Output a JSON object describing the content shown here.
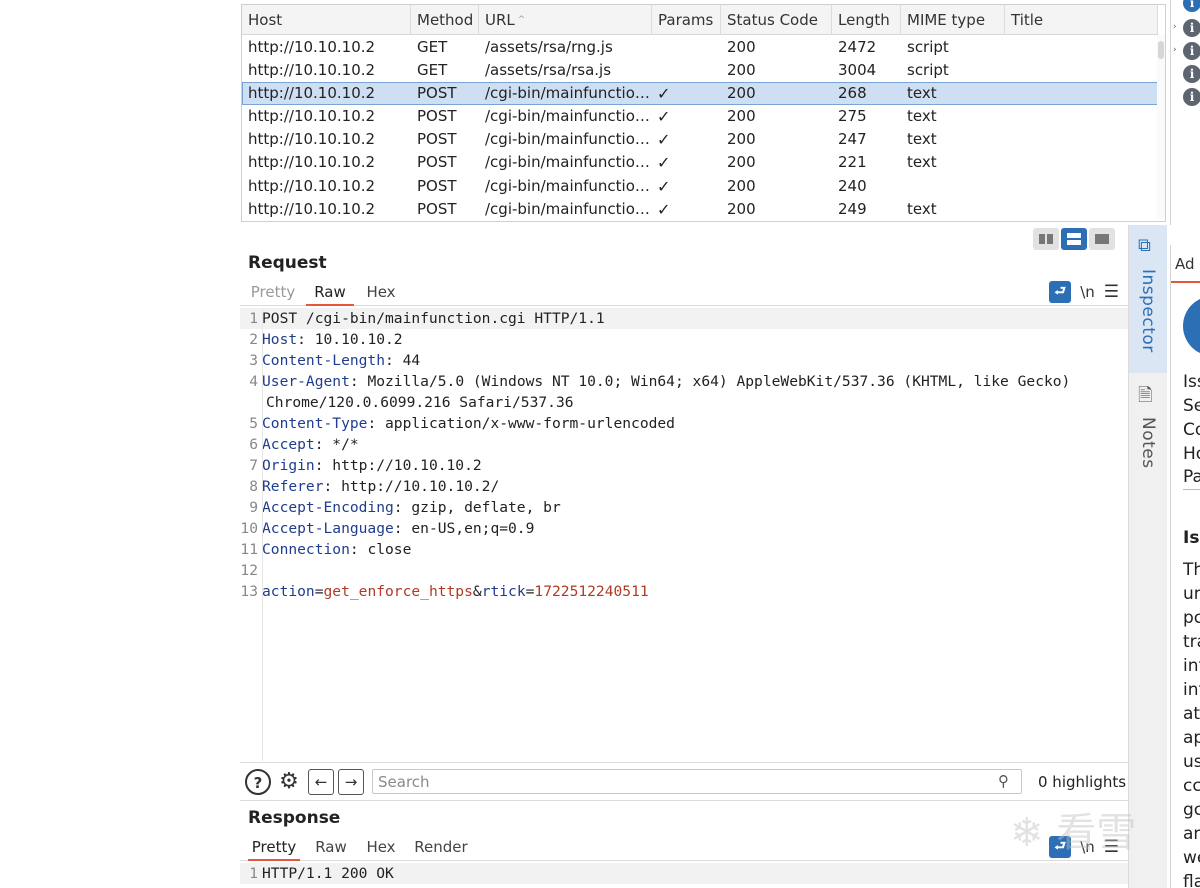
{
  "history": {
    "columns": [
      "Host",
      "Method",
      "URL",
      "Params",
      "Status Code",
      "Length",
      "MIME type",
      "Title"
    ],
    "rows": [
      {
        "host": "http://10.10.10.2",
        "method": "GET",
        "url": "/assets/rsa/rng.js",
        "params": "",
        "status": "200",
        "length": "2472",
        "mime": "script",
        "title": ""
      },
      {
        "host": "http://10.10.10.2",
        "method": "GET",
        "url": "/assets/rsa/rsa.js",
        "params": "",
        "status": "200",
        "length": "3004",
        "mime": "script",
        "title": ""
      },
      {
        "host": "http://10.10.10.2",
        "method": "POST",
        "url": "/cgi-bin/mainfunction....",
        "params": "✓",
        "status": "200",
        "length": "268",
        "mime": "text",
        "title": "",
        "selected": true
      },
      {
        "host": "http://10.10.10.2",
        "method": "POST",
        "url": "/cgi-bin/mainfunction....",
        "params": "✓",
        "status": "200",
        "length": "275",
        "mime": "text",
        "title": ""
      },
      {
        "host": "http://10.10.10.2",
        "method": "POST",
        "url": "/cgi-bin/mainfunction....",
        "params": "✓",
        "status": "200",
        "length": "247",
        "mime": "text",
        "title": ""
      },
      {
        "host": "http://10.10.10.2",
        "method": "POST",
        "url": "/cgi-bin/mainfunction....",
        "params": "✓",
        "status": "200",
        "length": "221",
        "mime": "text",
        "title": ""
      },
      {
        "host": "http://10.10.10.2",
        "method": "POST",
        "url": "/cgi-bin/mainfunction....",
        "params": "✓",
        "status": "200",
        "length": "240",
        "mime": "",
        "title": ""
      },
      {
        "host": "http://10.10.10.2",
        "method": "POST",
        "url": "/cgi-bin/mainfunction....",
        "params": "✓",
        "status": "200",
        "length": "249",
        "mime": "text",
        "title": ""
      }
    ]
  },
  "request": {
    "title": "Request",
    "tabs": [
      "Pretty",
      "Raw",
      "Hex"
    ],
    "active_tab": "Raw",
    "newline_label": "\\n",
    "request_line": "POST /cgi-bin/mainfunction.cgi HTTP/1.1",
    "headers": [
      {
        "line": 2,
        "name": "Host",
        "value": "10.10.10.2"
      },
      {
        "line": 3,
        "name": "Content-Length",
        "value": "44"
      },
      {
        "line": 4,
        "name": "User-Agent",
        "value": "Mozilla/5.0 (Windows NT 10.0; Win64; x64) AppleWebKit/537.36 (KHTML, like Gecko)",
        "wrap": "Chrome/120.0.6099.216 Safari/537.36"
      },
      {
        "line": 5,
        "name": "Content-Type",
        "value": "application/x-www-form-urlencoded"
      },
      {
        "line": 6,
        "name": "Accept",
        "value": "*/*"
      },
      {
        "line": 7,
        "name": "Origin",
        "value": "http://10.10.10.2"
      },
      {
        "line": 8,
        "name": "Referer",
        "value": "http://10.10.10.2/"
      },
      {
        "line": 9,
        "name": "Accept-Encoding",
        "value": "gzip, deflate, br"
      },
      {
        "line": 10,
        "name": "Accept-Language",
        "value": "en-US,en;q=0.9"
      },
      {
        "line": 11,
        "name": "Connection",
        "value": "close"
      }
    ],
    "body_params": [
      {
        "name": "action",
        "value": "get_enforce_https"
      },
      {
        "name": "rtick",
        "value": "1722512240511"
      }
    ]
  },
  "search": {
    "placeholder": "Search",
    "highlights": "0 highlights"
  },
  "response": {
    "title": "Response",
    "tabs": [
      "Pretty",
      "Raw",
      "Hex",
      "Render"
    ],
    "active_tab": "Pretty",
    "newline_label": "\\n",
    "status_line": "HTTP/1.1 200 OK"
  },
  "side_tabs": {
    "inspector": "Inspector",
    "notes": "Notes"
  },
  "issue_panel": {
    "tab": "Ad",
    "fields": [
      "Iss",
      "Se",
      "Co",
      "Ho",
      "Pa"
    ],
    "heading": "Iss",
    "body": [
      "Th",
      "ur",
      "pc",
      "tra",
      "int",
      "int",
      "at",
      "ap",
      "us",
      "cc",
      "gc",
      "an",
      "we",
      "fla"
    ]
  },
  "icons": {
    "help": "help-circle-icon",
    "settings": "gear-icon",
    "prev": "arrow-left-icon",
    "next": "arrow-right-icon",
    "search": "magnifier-icon",
    "wrap": "word-wrap-icon",
    "menu": "hamburger-menu-icon",
    "info": "info-icon"
  },
  "colors": {
    "accent": "#2d6fb5",
    "tab_underline": "#e8553a",
    "header_name": "#1f3d8e",
    "param_value": "#b13a25",
    "selected_row": "#cfdff3"
  }
}
